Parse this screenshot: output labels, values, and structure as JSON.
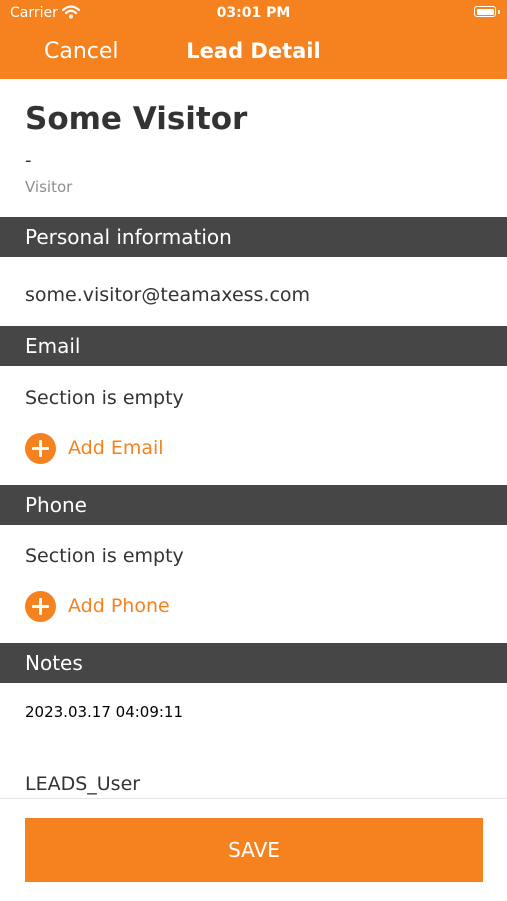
{
  "status_bar": {
    "carrier": "Carrier",
    "time": "03:01 PM"
  },
  "nav": {
    "cancel_label": "Cancel",
    "title": "Lead Detail"
  },
  "lead": {
    "name": "Some Visitor",
    "dash": "-",
    "type": "Visitor"
  },
  "sections": {
    "personal": {
      "title": "Personal information",
      "email_value": "some.visitor@teamaxess.com"
    },
    "email": {
      "title": "Email",
      "empty_text": "Section is empty",
      "add_label": "Add Email"
    },
    "phone": {
      "title": "Phone",
      "empty_text": "Section is empty",
      "add_label": "Add Phone"
    },
    "notes": {
      "title": "Notes",
      "date": "2023.03.17 04:09:11",
      "user": "LEADS_User"
    }
  },
  "footer": {
    "save_label": "SAVE"
  },
  "colors": {
    "accent": "#F5821F",
    "section_header_bg": "#464646",
    "text": "#333333"
  },
  "icons": {
    "wifi": "wifi-icon",
    "battery": "battery-icon",
    "add": "plus-circle-icon"
  }
}
